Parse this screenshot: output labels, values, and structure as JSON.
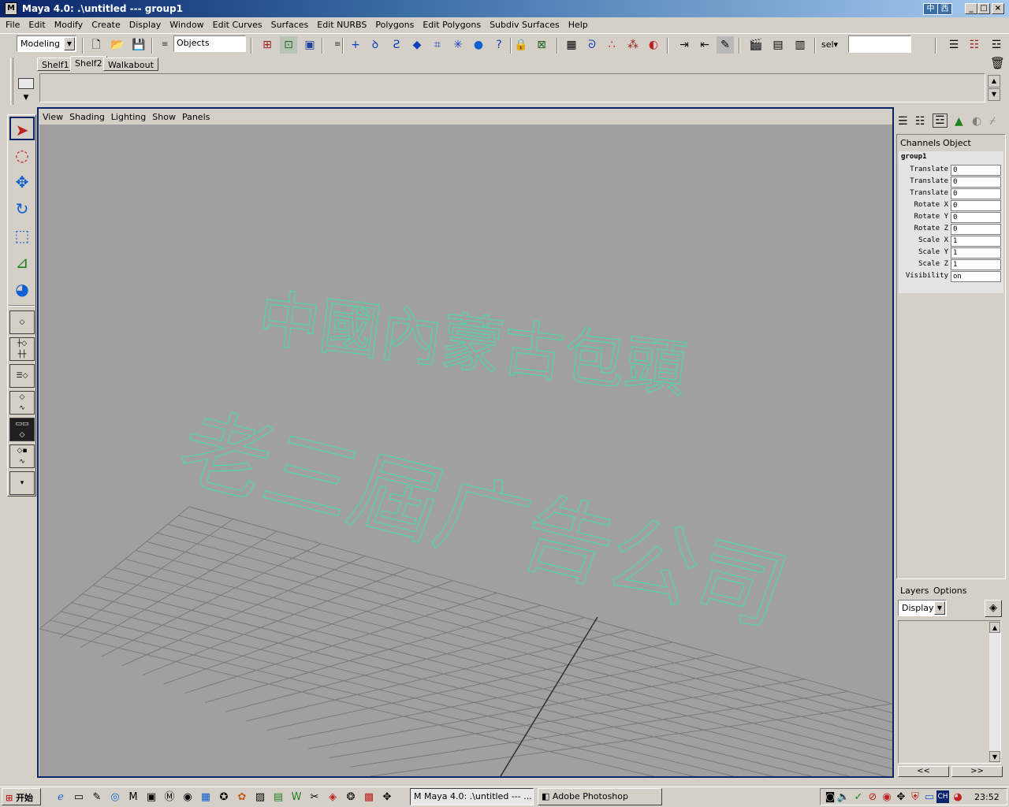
{
  "window": {
    "title": "Maya 4.0: .\\untitled   ---   group1",
    "ime_left": "中",
    "ime_right": "西",
    "min": "_",
    "max": "□",
    "close": "×"
  },
  "menu": [
    "File",
    "Edit",
    "Modify",
    "Create",
    "Display",
    "Window",
    "Edit Curves",
    "Surfaces",
    "Edit NURBS",
    "Polygons",
    "Edit Polygons",
    "Subdiv Surfaces",
    "Help"
  ],
  "statusline": {
    "menuset": "Modeling",
    "selection_mode": "Objects",
    "sel_label": "sel▾",
    "sel_value": ""
  },
  "shelf": {
    "tabs": [
      "Shelf1",
      "Shelf2",
      "Walkabout"
    ],
    "active_tab": "Shelf2"
  },
  "viewport": {
    "menu": [
      "View",
      "Shading",
      "Lighting",
      "Show",
      "Panels"
    ],
    "text_line1": "中國內蒙古包頭",
    "text_line2": "老三屆广告公司",
    "curve_color": "#40e0a0",
    "background": "#a0a0a0"
  },
  "channelbox": {
    "tabs": [
      "Channels",
      "Object"
    ],
    "object_name": "group1",
    "channels": [
      {
        "label": "Translate",
        "value": "0"
      },
      {
        "label": "Translate",
        "value": "0"
      },
      {
        "label": "Translate",
        "value": "0"
      },
      {
        "label": "Rotate X",
        "value": "0"
      },
      {
        "label": "Rotate Y",
        "value": "0"
      },
      {
        "label": "Rotate Z",
        "value": "0"
      },
      {
        "label": "Scale X",
        "value": "1"
      },
      {
        "label": "Scale Y",
        "value": "1"
      },
      {
        "label": "Scale Z",
        "value": "1"
      },
      {
        "label": "Visibility",
        "value": "on"
      }
    ]
  },
  "layers": {
    "tabs": [
      "Layers",
      "Options"
    ],
    "display": "Display",
    "nav_left": "<<",
    "nav_right": ">>"
  },
  "taskbar": {
    "start": "开始",
    "tasks": [
      "Maya 4.0: .\\untitled   ---  ...",
      "Adobe Photoshop"
    ],
    "lang": "CH",
    "clock": "23:52"
  }
}
